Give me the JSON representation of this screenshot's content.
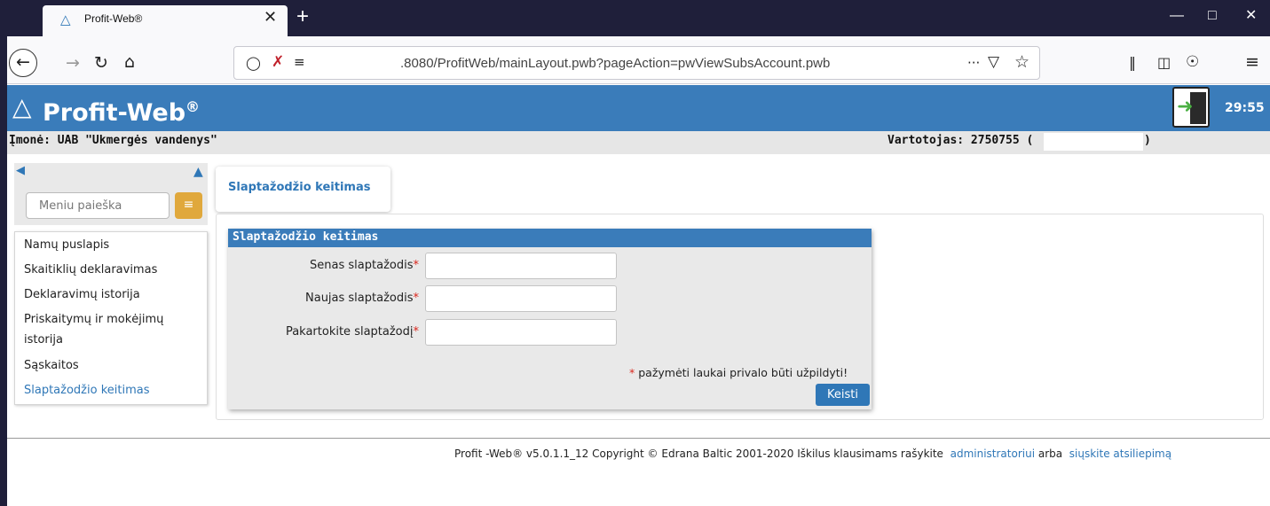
{
  "browser": {
    "tab_title": "Profit-Web®",
    "url": ".8080/ProfitWeb/mainLayout.pwb?pageAction=pwViewSubsAccount.pwb",
    "url_more": "···"
  },
  "app": {
    "title": "Profit-Web",
    "title_mark": "®",
    "timer": "29:55",
    "company": "Įmonė: UAB \"Ukmergės vandenys\"",
    "user": "Vartotojas: 2750755 (",
    "user_close": ")"
  },
  "sidebar": {
    "search_placeholder": "Meniu paieška",
    "items": [
      {
        "label": "Namų puslapis"
      },
      {
        "label": "Skaitiklių deklaravimas"
      },
      {
        "label": "Deklaravimų istorija"
      },
      {
        "label": "Priskaitymų ir mokėjimų"
      },
      {
        "label": "istorija"
      },
      {
        "label": "Sąskaitos"
      },
      {
        "label": "Slaptažodžio keitimas"
      }
    ]
  },
  "page": {
    "tab_label": "Slaptažodžio keitimas",
    "form_title": "Slaptažodžio keitimas",
    "fields": [
      {
        "label": "Senas slaptažodis",
        "value": ""
      },
      {
        "label": "Naujas slaptažodis",
        "value": ""
      },
      {
        "label": "Pakartokite slaptažodį",
        "value": ""
      }
    ],
    "required_mark": "*",
    "required_note": "pažymėti laukai privalo būti užpildyti!",
    "submit_label": "Keisti"
  },
  "footer": {
    "text": "Profit -Web® v5.0.1.1_12 Copyright © Edrana Baltic 2001-2020 Iškilus klausimams rašykite",
    "link1": "administratoriui",
    "middle": "arba",
    "link2": "siųskite atsiliepimą"
  }
}
